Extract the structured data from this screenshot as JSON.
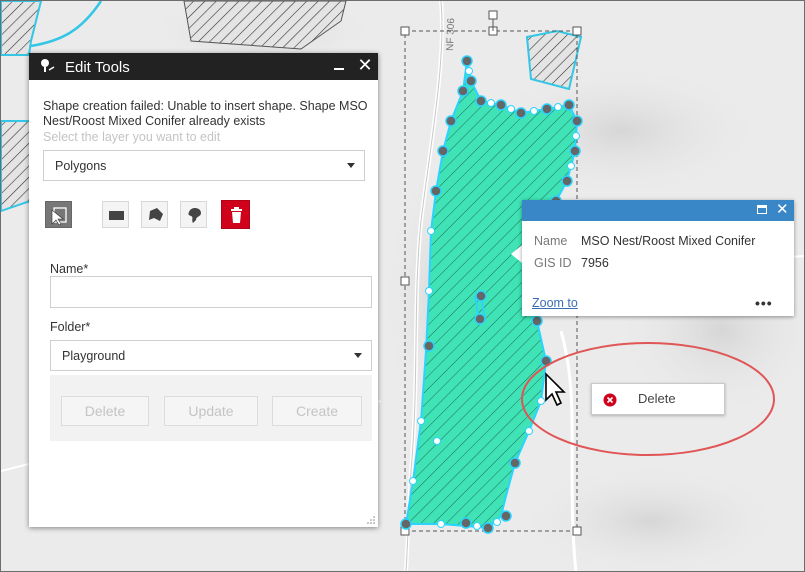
{
  "map": {
    "road_label": "NF 306"
  },
  "edit_panel": {
    "title": "Edit Tools",
    "message": "Shape creation failed: Unable to insert shape. Shape MSO Nest/Roost Mixed Conifer already exists",
    "layer_hint": "Select the layer you want to edit",
    "layer_select": "Polygons",
    "tools": [
      "select-edit-icon",
      "rectangle-icon",
      "polygon-icon",
      "freehand-icon",
      "trash-icon"
    ],
    "name_label": "Name*",
    "name_value": "",
    "folder_label": "Folder*",
    "folder_select": "Playground",
    "buttons": {
      "delete": "Delete",
      "update": "Update",
      "create": "Create"
    }
  },
  "popup": {
    "rows": [
      {
        "key": "Name",
        "value": "MSO Nest/Roost Mixed Conifer"
      },
      {
        "key": "GIS ID",
        "value": "7956"
      }
    ],
    "zoom_link": "Zoom to",
    "more": "•••"
  },
  "context_menu": {
    "delete_label": "Delete"
  },
  "colors": {
    "polygon_fill": "#3fe3b5",
    "highlight_stroke": "#2ad4ff",
    "panel_header": "#222222",
    "popup_header": "#3a87c8",
    "delete_button": "#d0021b",
    "annotation_ellipse": "#e05555"
  }
}
